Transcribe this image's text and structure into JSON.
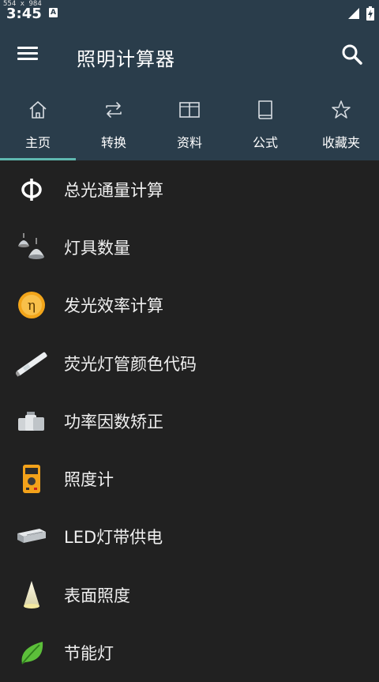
{
  "status_bar": {
    "dims": "554 x 984",
    "time": "3:45",
    "notification_letter": "A"
  },
  "toolbar": {
    "title": "照明计算器"
  },
  "tabs": [
    {
      "label": "主页",
      "icon": "home-icon"
    },
    {
      "label": "转换",
      "icon": "swap-icon"
    },
    {
      "label": "资料",
      "icon": "book-open-icon"
    },
    {
      "label": "公式",
      "icon": "book-icon"
    },
    {
      "label": "收藏夹",
      "icon": "star-icon"
    }
  ],
  "active_tab": "主页",
  "items": [
    {
      "label": "总光通量计算",
      "icon": "phi-icon"
    },
    {
      "label": "灯具数量",
      "icon": "lamp-fixture-icon"
    },
    {
      "label": "发光效率计算",
      "icon": "eta-coin-icon"
    },
    {
      "label": "荧光灯管颜色代码",
      "icon": "fluorescent-tube-icon"
    },
    {
      "label": "功率因数矫正",
      "icon": "capacitor-icon"
    },
    {
      "label": "照度计",
      "icon": "multimeter-icon"
    },
    {
      "label": "LED灯带供电",
      "icon": "power-supply-icon"
    },
    {
      "label": "表面照度",
      "icon": "light-cone-icon"
    },
    {
      "label": "节能灯",
      "icon": "leaf-icon"
    }
  ],
  "colors": {
    "header": "#2a3d4b",
    "background": "#212121",
    "accent": "#5fb8b0"
  }
}
